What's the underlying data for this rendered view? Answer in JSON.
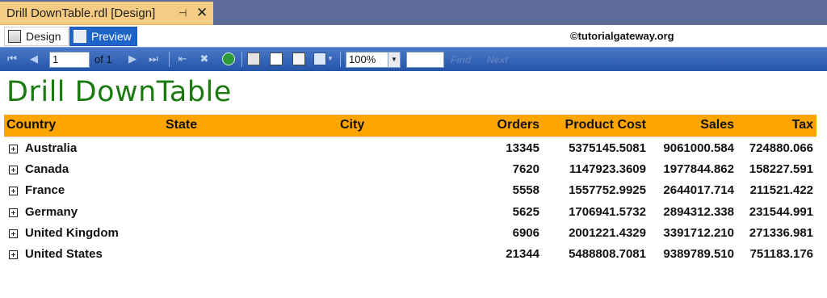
{
  "window": {
    "doc_tab_title": "Drill DownTable.rdl [Design]",
    "pin_icon": "pin-icon",
    "close_icon": "close-icon"
  },
  "view_tabs": {
    "design_label": "Design",
    "preview_label": "Preview",
    "active": "Preview"
  },
  "watermark": "©tutorialgateway.org",
  "toolbar": {
    "current_page": "1",
    "of_label": "of  1",
    "zoom": "100%",
    "find_label": "Find",
    "next_label": "Next",
    "icons": [
      "first-page-icon",
      "previous-page-icon",
      "next-page-icon",
      "last-page-icon",
      "back-icon",
      "stop-icon",
      "refresh-icon",
      "print-icon",
      "print-layout-icon",
      "page-setup-icon",
      "export-icon"
    ]
  },
  "report": {
    "title": "Drill DownTable",
    "header_color": "#ffa500",
    "title_color": "#1a7a10",
    "columns": [
      "Country",
      "State",
      "City",
      "Orders",
      "Product Cost",
      "Sales",
      "Tax"
    ],
    "rows": [
      {
        "country": "Australia",
        "orders": "13345",
        "product_cost": "5375145.5081",
        "sales": "9061000.584",
        "tax": "724880.066"
      },
      {
        "country": "Canada",
        "orders": "7620",
        "product_cost": "1147923.3609",
        "sales": "1977844.862",
        "tax": "158227.591"
      },
      {
        "country": "France",
        "orders": "5558",
        "product_cost": "1557752.9925",
        "sales": "2644017.714",
        "tax": "211521.422"
      },
      {
        "country": "Germany",
        "orders": "5625",
        "product_cost": "1706941.5732",
        "sales": "2894312.338",
        "tax": "231544.991"
      },
      {
        "country": "United Kingdom",
        "orders": "6906",
        "product_cost": "2001221.4329",
        "sales": "3391712.210",
        "tax": "271336.981"
      },
      {
        "country": "United States",
        "orders": "21344",
        "product_cost": "5488808.7081",
        "sales": "9389789.510",
        "tax": "751183.176"
      }
    ]
  }
}
